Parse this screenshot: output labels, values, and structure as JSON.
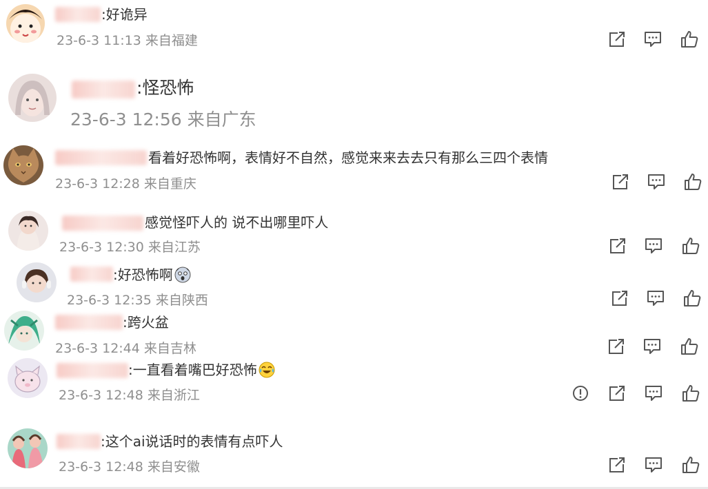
{
  "comments": [
    {
      "text": ":好诡异",
      "time": "23-6-3 11:13",
      "location": "来自福建"
    },
    {
      "text": ":怪恐怖",
      "time": "23-6-3 12:56",
      "location": "来自广东"
    },
    {
      "text": "看着好恐怖啊，表情好不自然，感觉来来去去只有那么三四个表情",
      "time": "23-6-3 12:28",
      "location": "来自重庆"
    },
    {
      "text": "感觉怪吓人的 说不出哪里吓人",
      "time": "23-6-3 12:30",
      "location": "来自江苏"
    },
    {
      "text": ":好恐怖啊",
      "time": "23-6-3 12:35",
      "location": "来自陕西"
    },
    {
      "text": ":跨火盆",
      "time": "23-6-3 12:44",
      "location": "来自吉林"
    },
    {
      "text": ":一直看着嘴巴好恐怖",
      "time": "23-6-3 12:48",
      "location": "来自浙江"
    },
    {
      "text": ":这个ai说话时的表情有点吓人",
      "time": "23-6-3 12:48",
      "location": "来自安徽"
    }
  ],
  "icons": {
    "share": "share-icon",
    "reply": "comment-icon",
    "like": "thumbs-up-icon",
    "report": "report-icon",
    "emoji_scared": "scared-emoji",
    "emoji_laugh": "laugh-cry-emoji"
  },
  "colors": {
    "text": "#333333",
    "meta": "#8f8f8f",
    "icon": "#555555"
  }
}
